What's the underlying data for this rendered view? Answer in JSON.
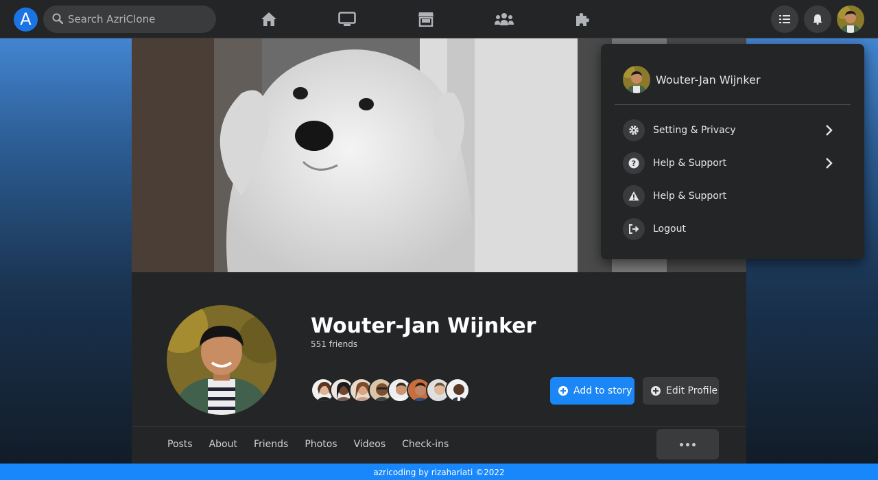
{
  "app": {
    "logo_letter": "A",
    "search": {
      "placeholder": "Search AzriClone"
    }
  },
  "nav": [
    "home-icon",
    "tv-icon",
    "store-icon",
    "group-icon",
    "puzzle-icon"
  ],
  "header_actions": [
    "list-icon",
    "bell-icon",
    "avatar"
  ],
  "profile": {
    "name": "Wouter-Jan Wijnker",
    "friends_count": "551 friends",
    "add_story_label": "Add to story",
    "edit_profile_label": "Edit Profile",
    "tabs": [
      "Posts",
      "About",
      "Friends",
      "Photos",
      "Videos",
      "Check-ins"
    ]
  },
  "dropdown": {
    "user_name": "Wouter-Jan Wijnker",
    "items": [
      {
        "label": "Setting & Privacy",
        "icon": "gear-icon",
        "chevron": true
      },
      {
        "label": "Help & Support",
        "icon": "question-icon",
        "chevron": true
      },
      {
        "label": "Help & Support",
        "icon": "warning-icon",
        "chevron": false
      },
      {
        "label": "Logout",
        "icon": "logout-icon",
        "chevron": false
      }
    ]
  },
  "footer": {
    "text": "azricoding by rizahariati ©2022"
  },
  "colors": {
    "accent": "#1b86f5",
    "bar": "#242526",
    "surface": "#3a3b3c"
  }
}
